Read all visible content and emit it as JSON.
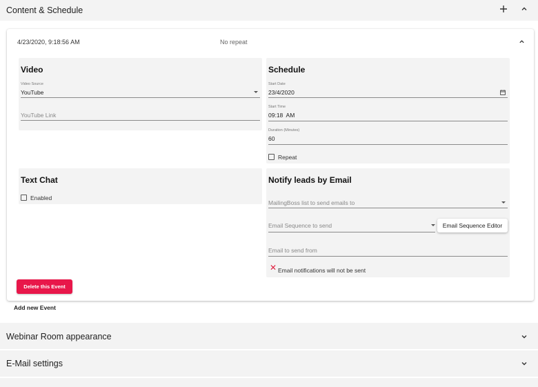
{
  "sections": {
    "content_schedule": {
      "title": "Content & Schedule"
    },
    "webinar_room": {
      "title": "Webinar Room appearance"
    },
    "email_settings": {
      "title": "E-Mail settings"
    }
  },
  "event": {
    "datetime": "4/23/2020, 9:18:56 AM",
    "repeat_summary": "No repeat",
    "video": {
      "title": "Video",
      "source_label": "Video Source",
      "source_value": "YouTube",
      "link_placeholder": "YouTube Link"
    },
    "schedule": {
      "title": "Schedule",
      "start_date_label": "Start Date",
      "start_date_value": "23/4/2020",
      "start_time_label": "Start Time",
      "start_time_value": "09:18  AM",
      "duration_label": "Duration (Minutes)",
      "duration_value": "60",
      "repeat_label": "Repeat",
      "repeat_checked": false
    },
    "text_chat": {
      "title": "Text Chat",
      "enabled_label": "Enabled",
      "enabled_checked": false
    },
    "notify": {
      "title": "Notify leads by Email",
      "list_placeholder": "MailingBoss list to send emails to",
      "sequence_placeholder": "Email Sequence to send",
      "sequence_editor_label": "Email Sequence Editor",
      "from_placeholder": "Email to send from",
      "notice": "Email notifications will not be sent"
    },
    "delete_label": "Delete this Event"
  },
  "add_event_label": "Add new Event",
  "icons": {
    "add": "plus-icon",
    "collapse": "chevron-up-icon",
    "expand": "chevron-down-icon",
    "calendar": "calendar-icon",
    "warning": "close-icon"
  },
  "colors": {
    "accent": "#e8174a",
    "notice": "#e02040",
    "panel": "#f3f3f3"
  }
}
